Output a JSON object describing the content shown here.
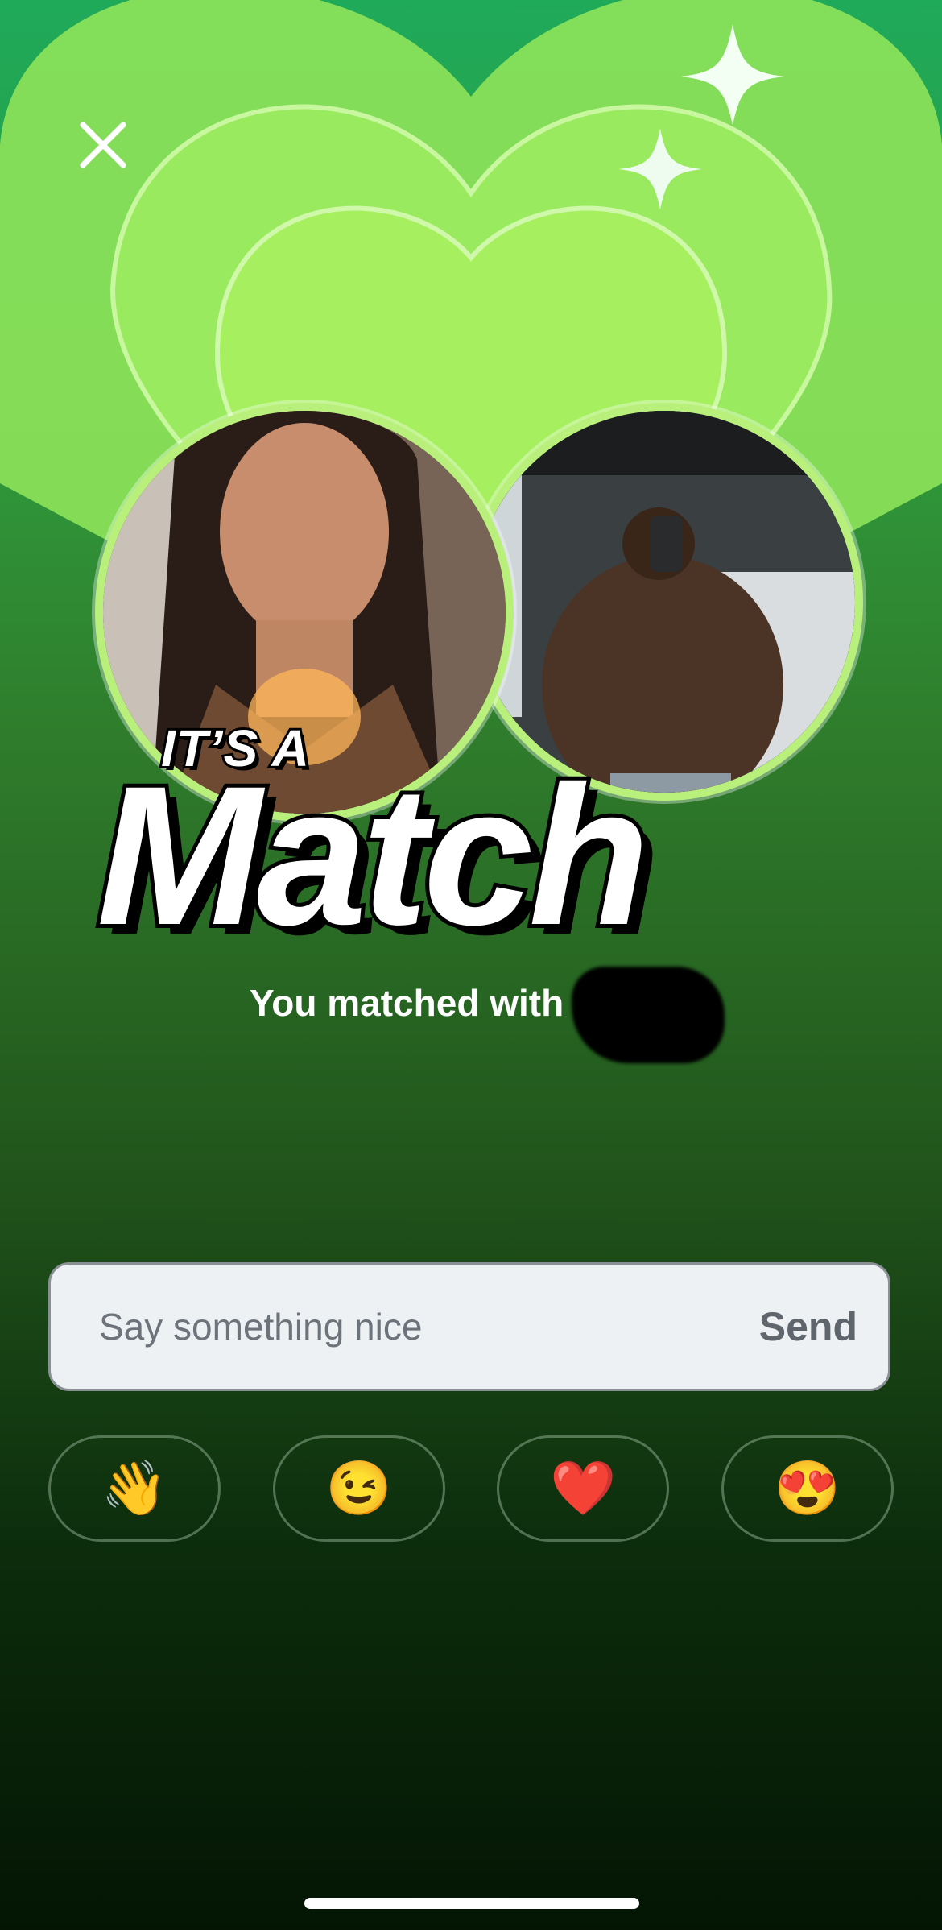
{
  "header": {
    "close_icon": "close-icon"
  },
  "match_banner": {
    "eyebrow": "IT’S A",
    "title": "Match",
    "subtitle": "You matched with"
  },
  "message": {
    "placeholder": "Say something nice",
    "send_label": "Send"
  },
  "quick_replies": [
    {
      "emoji": "👋",
      "name": "waving-hand"
    },
    {
      "emoji": "😉",
      "name": "winking-face"
    },
    {
      "emoji": "❤️",
      "name": "red-heart"
    },
    {
      "emoji": "😍",
      "name": "heart-eyes"
    }
  ],
  "colors": {
    "accent_green": "#a8f25c",
    "background_top": "#1faa5a",
    "background_bottom": "#041504"
  }
}
